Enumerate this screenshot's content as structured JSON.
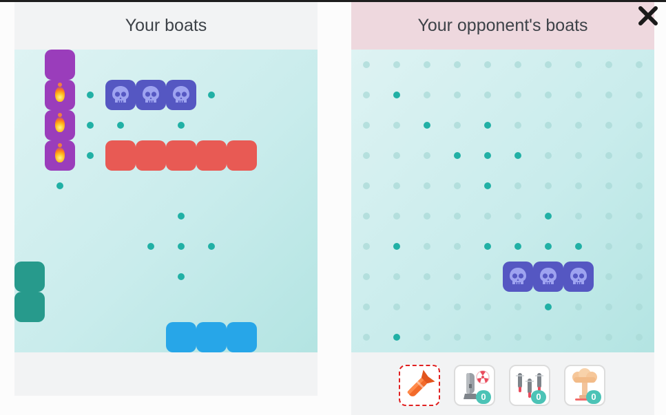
{
  "left_panel": {
    "title": "Your boats",
    "ships": [
      {
        "color": "#9a3dbb",
        "cells": [
          {
            "row": 0,
            "col": 1,
            "hit": false
          },
          {
            "row": 1,
            "col": 1,
            "hit": true
          },
          {
            "row": 2,
            "col": 1,
            "hit": true
          },
          {
            "row": 3,
            "col": 1,
            "hit": true
          }
        ]
      },
      {
        "color": "#5557c2",
        "sunk": true,
        "cells": [
          {
            "row": 1,
            "col": 3
          },
          {
            "row": 1,
            "col": 4
          },
          {
            "row": 1,
            "col": 5
          }
        ]
      },
      {
        "color": "#e85a54",
        "cells": [
          {
            "row": 3,
            "col": 3
          },
          {
            "row": 3,
            "col": 4
          },
          {
            "row": 3,
            "col": 5
          },
          {
            "row": 3,
            "col": 6
          },
          {
            "row": 3,
            "col": 7
          }
        ]
      },
      {
        "color": "#279a8c",
        "cells": [
          {
            "row": 7,
            "col": 0
          },
          {
            "row": 8,
            "col": 0
          }
        ]
      },
      {
        "color": "#27a6e8",
        "cells": [
          {
            "row": 9,
            "col": 5
          },
          {
            "row": 9,
            "col": 6
          },
          {
            "row": 9,
            "col": 7
          }
        ]
      }
    ],
    "misses": [
      [
        1,
        2
      ],
      [
        1,
        6
      ],
      [
        2,
        2
      ],
      [
        2,
        3
      ],
      [
        2,
        5
      ],
      [
        3,
        2
      ],
      [
        4,
        1
      ],
      [
        5,
        5
      ],
      [
        6,
        4
      ],
      [
        6,
        5
      ],
      [
        6,
        6
      ],
      [
        7,
        5
      ]
    ]
  },
  "right_panel": {
    "title": "Your opponent's boats",
    "misses": [
      [
        1,
        1
      ],
      [
        2,
        2
      ],
      [
        2,
        4
      ],
      [
        3,
        3
      ],
      [
        3,
        4
      ],
      [
        3,
        5
      ],
      [
        4,
        4
      ],
      [
        5,
        6
      ],
      [
        6,
        1
      ],
      [
        6,
        4
      ],
      [
        6,
        5
      ],
      [
        6,
        6
      ],
      [
        6,
        7
      ],
      [
        8,
        6
      ],
      [
        9,
        1
      ]
    ],
    "sunk_ships": [
      {
        "color": "#5557c2",
        "cells": [
          {
            "row": 7,
            "col": 5
          },
          {
            "row": 7,
            "col": 6
          },
          {
            "row": 7,
            "col": 7
          }
        ]
      }
    ]
  },
  "weapons": [
    {
      "icon": "torpedo-icon",
      "selected": true
    },
    {
      "icon": "nuclear-bomb-icon",
      "count": "0",
      "selected": false
    },
    {
      "icon": "triple-missile-icon",
      "count": "0",
      "selected": false
    },
    {
      "icon": "mushroom-cloud-icon",
      "count": "0",
      "selected": false
    }
  ]
}
